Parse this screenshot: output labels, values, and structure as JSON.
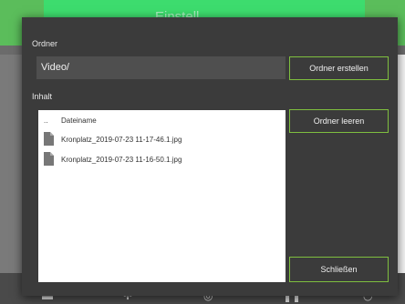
{
  "background": {
    "title": "Einstell..."
  },
  "dialog": {
    "folder_label": "Ordner",
    "path_value": "Video/",
    "create_folder_label": "Ordner erstellen",
    "content_label": "Inhalt",
    "empty_folder_label": "Ordner leeren",
    "close_label": "Schließen",
    "file_list": {
      "parent_marker": "..",
      "column_header": "Dateiname",
      "rows": [
        {
          "name": "Kronplatz_2019-07-23 11-17-46.1.jpg"
        },
        {
          "name": "Kronplatz_2019-07-23 11-16-50.1.jpg"
        }
      ]
    }
  },
  "colors": {
    "accent_green": "#7fbf3f",
    "dialog_bg": "#3b3b3b"
  }
}
